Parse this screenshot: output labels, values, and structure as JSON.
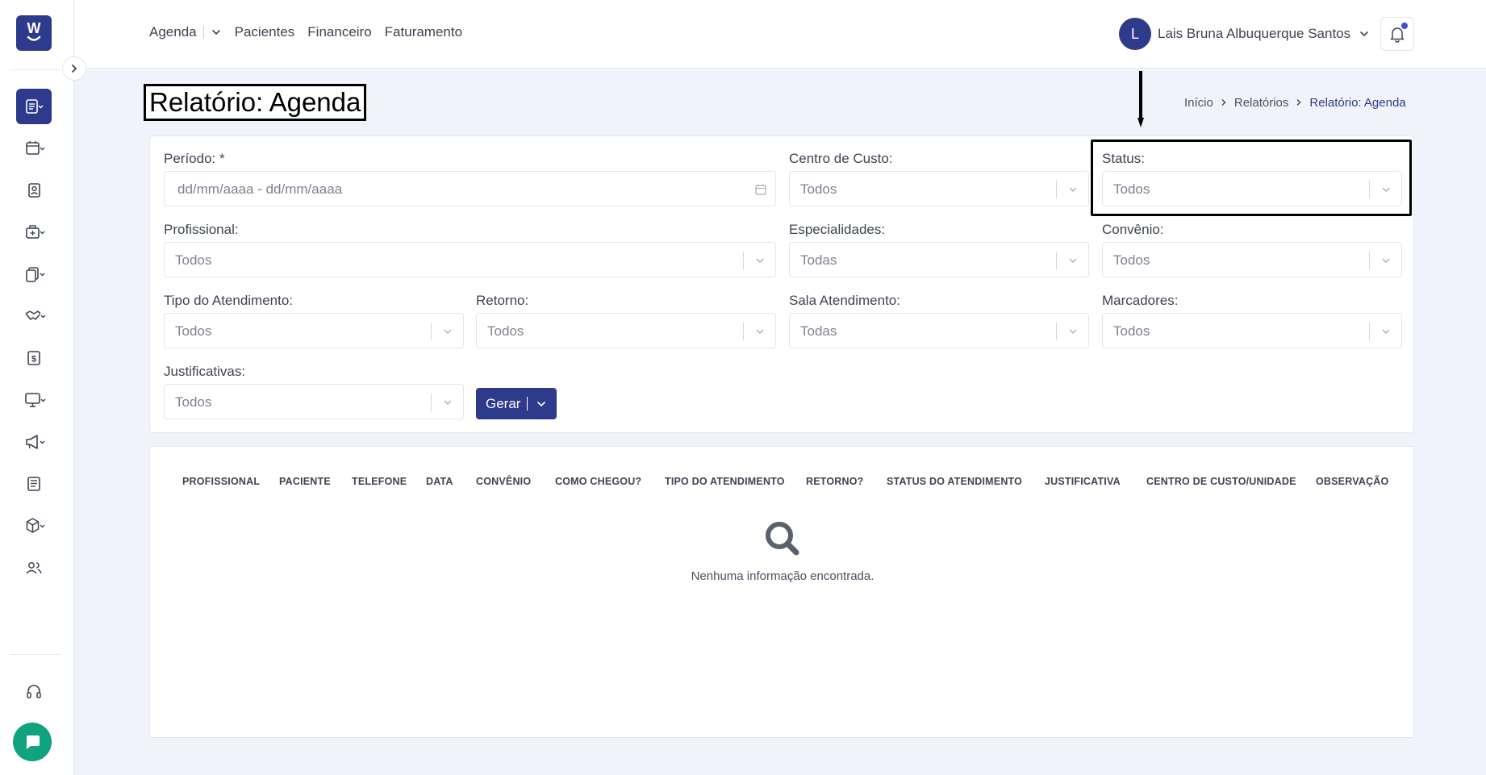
{
  "topnav": {
    "agenda": "Agenda",
    "pacientes": "Pacientes",
    "financeiro": "Financeiro",
    "faturamento": "Faturamento"
  },
  "user": {
    "initial": "L",
    "name": "Lais Bruna Albuquerque Santos"
  },
  "logo_text": "W",
  "page": {
    "title": "Relatório: Agenda"
  },
  "breadcrumb": {
    "items": [
      "Início",
      "Relatórios",
      "Relatório: Agenda"
    ]
  },
  "filters": {
    "periodo": {
      "label": "Período: *",
      "placeholder": "dd/mm/aaaa - dd/mm/aaaa"
    },
    "centro_custo": {
      "label": "Centro de Custo:",
      "value": "Todos"
    },
    "status": {
      "label": "Status:",
      "value": "Todos"
    },
    "profissional": {
      "label": "Profissional:",
      "value": "Todos"
    },
    "especialidades": {
      "label": "Especialidades:",
      "value": "Todas"
    },
    "convenio": {
      "label": "Convênio:",
      "value": "Todos"
    },
    "tipo_atendimento": {
      "label": "Tipo do Atendimento:",
      "value": "Todos"
    },
    "retorno": {
      "label": "Retorno:",
      "value": "Todos"
    },
    "sala_atendimento": {
      "label": "Sala Atendimento:",
      "value": "Todas"
    },
    "marcadores": {
      "label": "Marcadores:",
      "value": "Todos"
    },
    "justificativas": {
      "label": "Justificativas:",
      "value": "Todos"
    }
  },
  "gerar_label": "Gerar",
  "table": {
    "columns": [
      "PROFISSIONAL",
      "PACIENTE",
      "TELEFONE",
      "DATA",
      "CONVÊNIO",
      "COMO CHEGOU?",
      "TIPO DO ATENDIMENTO",
      "RETORNO?",
      "STATUS DO ATENDIMENTO",
      "JUSTIFICATIVA",
      "CENTRO DE CUSTO/UNIDADE",
      "OBSERVAÇÃO"
    ],
    "empty_message": "Nenhuma informação encontrada."
  },
  "colors": {
    "primary": "#2e3a8c",
    "chat": "#10a37f",
    "notification_dot": "#3b4fe0"
  },
  "icons": {
    "sidebar": [
      "report-icon",
      "calendar-icon",
      "contact-card-icon",
      "medical-bag-icon",
      "documents-icon",
      "handshake-icon",
      "dollar-icon",
      "monitor-icon",
      "megaphone-icon",
      "newspaper-icon",
      "box-icon",
      "users-icon",
      "headset-icon"
    ]
  }
}
